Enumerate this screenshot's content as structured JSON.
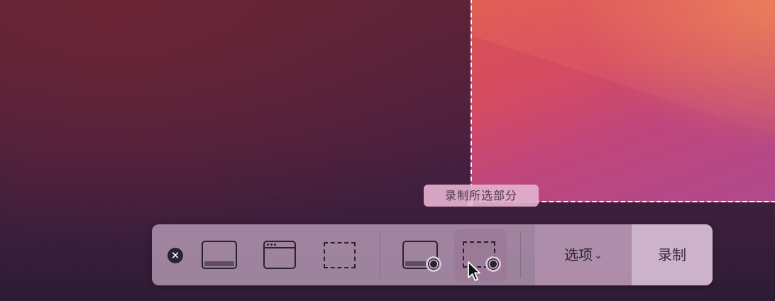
{
  "tooltip": {
    "text": "录制所选部分"
  },
  "toolbar": {
    "close_icon": "close-icon",
    "buttons": [
      {
        "name": "capture-entire-screen",
        "icon": "screen-capture-icon"
      },
      {
        "name": "capture-window",
        "icon": "window-capture-icon"
      },
      {
        "name": "capture-selection",
        "icon": "selection-capture-icon"
      },
      {
        "name": "record-entire-screen",
        "icon": "screen-record-icon"
      },
      {
        "name": "record-selection",
        "icon": "selection-record-icon",
        "selected": true
      }
    ],
    "options_label": "选项",
    "options_chevron": "⌄",
    "record_label": "录制"
  },
  "colors": {
    "accent_dark": "#2b2230",
    "selection_border": "#ffffff",
    "toolbar_bg": "#c8aac6"
  }
}
